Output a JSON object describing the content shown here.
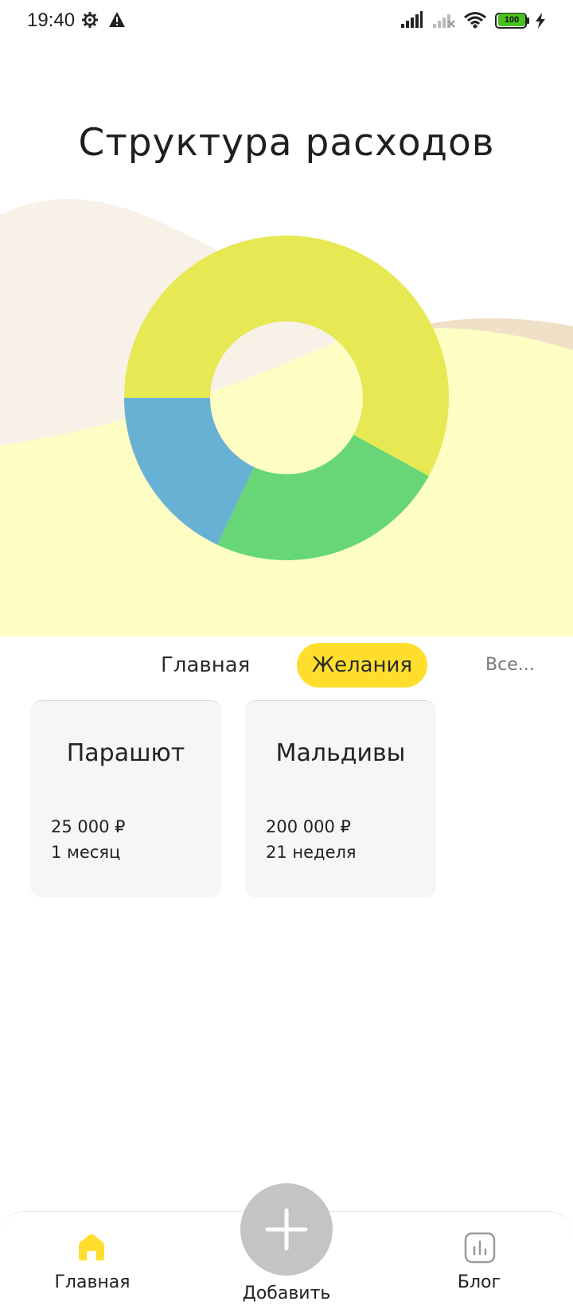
{
  "status_bar": {
    "time": "19:40",
    "battery": "100",
    "icons": [
      "gear-icon",
      "warning-icon",
      "signal-icon",
      "signal-off-icon",
      "wifi-icon",
      "battery-icon",
      "charging-icon"
    ]
  },
  "header": {
    "title": "Структура расходов"
  },
  "chart_data": {
    "type": "pie",
    "donut": true,
    "categories": [
      "",
      "",
      ""
    ],
    "values": [
      58,
      24,
      18
    ],
    "colors": [
      "#e6e854",
      "#66d677",
      "#67b1d4"
    ]
  },
  "tabs": [
    {
      "label": "Главная",
      "active": false
    },
    {
      "label": "Желания",
      "active": true
    },
    {
      "label": "Все...",
      "active": false
    }
  ],
  "cards": [
    {
      "title": "Парашют",
      "amount": "25 000 ₽",
      "term": "1 месяц"
    },
    {
      "title": "Мальдивы",
      "amount": "200 000 ₽",
      "term": "21 неделя"
    }
  ],
  "bottom_nav": {
    "home_label": "Главная",
    "add_label": "Добавить",
    "blog_label": "Блог",
    "accent": "#ffde2e"
  },
  "colors": {
    "accent": "#ffde2e",
    "card_bg": "#f5f6f8",
    "add_button": "#c4c4c4"
  }
}
